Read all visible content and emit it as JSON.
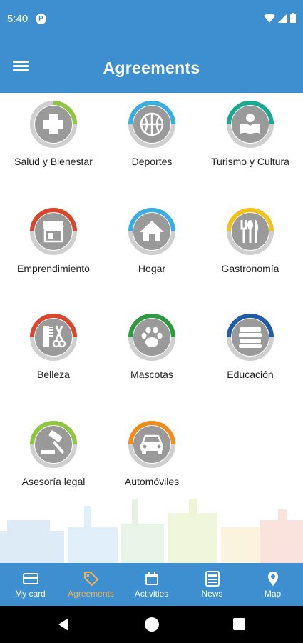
{
  "status": {
    "time": "5:40",
    "app_icon": "P"
  },
  "header": {
    "title": "Agreements",
    "menu_icon": "hamburger-icon"
  },
  "categories": [
    {
      "label": "Salud y Bienestar",
      "icon": "health-cross-icon",
      "ring_color": "#8dc63f"
    },
    {
      "label": "Deportes",
      "icon": "basketball-icon",
      "ring_color": "#3aaee0"
    },
    {
      "label": "Turismo y Cultura",
      "icon": "book-reader-icon",
      "ring_color": "#1aa88f"
    },
    {
      "label": "Emprendimiento",
      "icon": "storefront-icon",
      "ring_color": "#d9462b"
    },
    {
      "label": "Hogar",
      "icon": "house-icon",
      "ring_color": "#3aaee0"
    },
    {
      "label": "Gastronomía",
      "icon": "cutlery-icon",
      "ring_color": "#f2c21b"
    },
    {
      "label": "Belleza",
      "icon": "comb-scissors-icon",
      "ring_color": "#d9462b"
    },
    {
      "label": "Mascotas",
      "icon": "paw-icon",
      "ring_color": "#2e9a3e"
    },
    {
      "label": "Educación",
      "icon": "books-stack-icon",
      "ring_color": "#1f5ba8"
    },
    {
      "label": "Asesoría legal",
      "icon": "gavel-icon",
      "ring_color": "#8dc63f"
    },
    {
      "label": "Automóviles",
      "icon": "car-icon",
      "ring_color": "#f08c1d"
    }
  ],
  "bottom_nav": [
    {
      "label": "My card",
      "icon": "card-icon",
      "active": false
    },
    {
      "label": "Agreements",
      "icon": "tag-icon",
      "active": true
    },
    {
      "label": "Activities",
      "icon": "calendar-icon",
      "active": false
    },
    {
      "label": "News",
      "icon": "newspaper-icon",
      "active": false
    },
    {
      "label": "Map",
      "icon": "map-pin-icon",
      "active": false
    }
  ],
  "colors": {
    "primary": "#3d8fcf",
    "active_nav": "#f5b14a",
    "badge_grey": "#9a9a9a"
  }
}
